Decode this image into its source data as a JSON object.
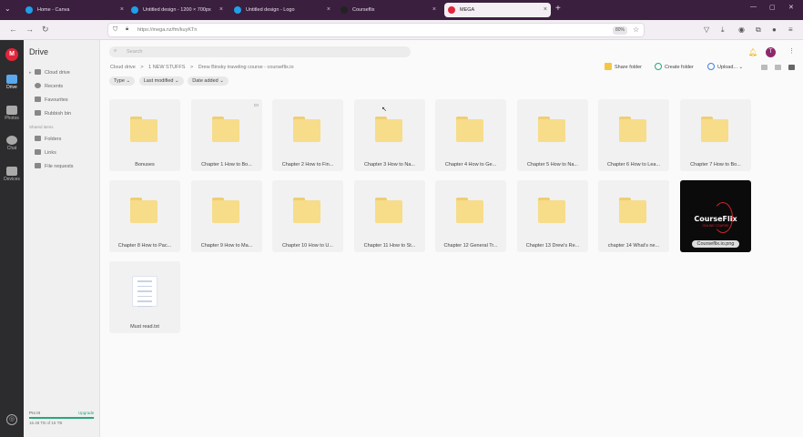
{
  "browser": {
    "tabs": [
      {
        "label": "Home - Canva",
        "fav": "#1fa0e8",
        "active": false
      },
      {
        "label": "Untitled design - 1200 × 700px",
        "fav": "#1fa0e8",
        "active": false
      },
      {
        "label": "Untitled design - Logo",
        "fav": "#1fa0e8",
        "active": false
      },
      {
        "label": "Courseflix",
        "fav": "#222222",
        "active": false
      },
      {
        "label": "MEGA",
        "fav": "#e0263a",
        "active": true
      }
    ],
    "url": "https://mega.nz/fm/kuyKTn",
    "zoom": "80%",
    "new_tab_icon": "+"
  },
  "rail": {
    "logo": "M",
    "items": [
      {
        "label": "Drive",
        "icon": "drive-icon"
      },
      {
        "label": "Photos",
        "icon": "photos-icon"
      },
      {
        "label": "Chat",
        "icon": "chat-icon"
      },
      {
        "label": "Devices",
        "icon": "devices-icon"
      }
    ]
  },
  "side": {
    "title": "Drive",
    "items": [
      {
        "label": "Cloud drive",
        "icon": "cloud-icon"
      },
      {
        "label": "Recents",
        "icon": "clock-icon"
      },
      {
        "label": "Favourites",
        "icon": "heart-icon"
      },
      {
        "label": "Rubbish bin",
        "icon": "trash-icon"
      }
    ],
    "shared_heading": "Shared items",
    "shared_items": [
      {
        "label": "Folders",
        "icon": "shared-folder-icon"
      },
      {
        "label": "Links",
        "icon": "link-icon"
      },
      {
        "label": "File requests",
        "icon": "file-request-icon"
      }
    ],
    "plan": "Pro III",
    "upgrade": "Upgrade",
    "usage": "16.48 TB of 16 TB",
    "usage_fraction": 0.98
  },
  "main": {
    "search_placeholder": "Search",
    "breadcrumbs": [
      "Cloud drive",
      ">",
      "1 NEW STUFFS",
      ">",
      "Drew Binsky traveling course - courseflix.io"
    ],
    "actions": {
      "share": "Share folder",
      "create": "Create folder",
      "upload": "Upload..."
    },
    "filters": [
      "Type ⌄",
      "Last modified ⌄",
      "Date added ⌄"
    ],
    "avatar_initial": "T",
    "items": [
      {
        "label": "Bonuses",
        "kind": "folder",
        "badge": ""
      },
      {
        "label": "Chapter 1 How to Bo...",
        "kind": "folder",
        "badge": "co"
      },
      {
        "label": "Chapter 2 How to Fin...",
        "kind": "folder",
        "badge": ""
      },
      {
        "label": "Chapter 3 How to Na...",
        "kind": "folder",
        "badge": ""
      },
      {
        "label": "Chapter 4 How to Ge...",
        "kind": "folder",
        "badge": ""
      },
      {
        "label": "Chapter 5 How to Na...",
        "kind": "folder",
        "badge": ""
      },
      {
        "label": "Chapter 6 How to Lea...",
        "kind": "folder",
        "badge": ""
      },
      {
        "label": "Chapter 7 How to Bo...",
        "kind": "folder",
        "badge": ""
      },
      {
        "label": "Chapter 8 How to Pac...",
        "kind": "folder",
        "badge": ""
      },
      {
        "label": "Chapter 9 How to Ma...",
        "kind": "folder",
        "badge": ""
      },
      {
        "label": "Chapter 10 How to U...",
        "kind": "folder",
        "badge": ""
      },
      {
        "label": "Chapter 11 How to St...",
        "kind": "folder",
        "badge": ""
      },
      {
        "label": "Chapter 12 General Tr...",
        "kind": "folder",
        "badge": ""
      },
      {
        "label": "Chapter 13 Drew's Re...",
        "kind": "folder",
        "badge": ""
      },
      {
        "label": "chapter 14 What's ne...",
        "kind": "folder",
        "badge": ""
      },
      {
        "label": "Courseflix.io.png",
        "kind": "image",
        "badge": "",
        "thumb_text": "CourseFlix",
        "thumb_sub": "ONLINE COURSE"
      },
      {
        "label": "Must read.txt",
        "kind": "text",
        "badge": ""
      }
    ]
  }
}
